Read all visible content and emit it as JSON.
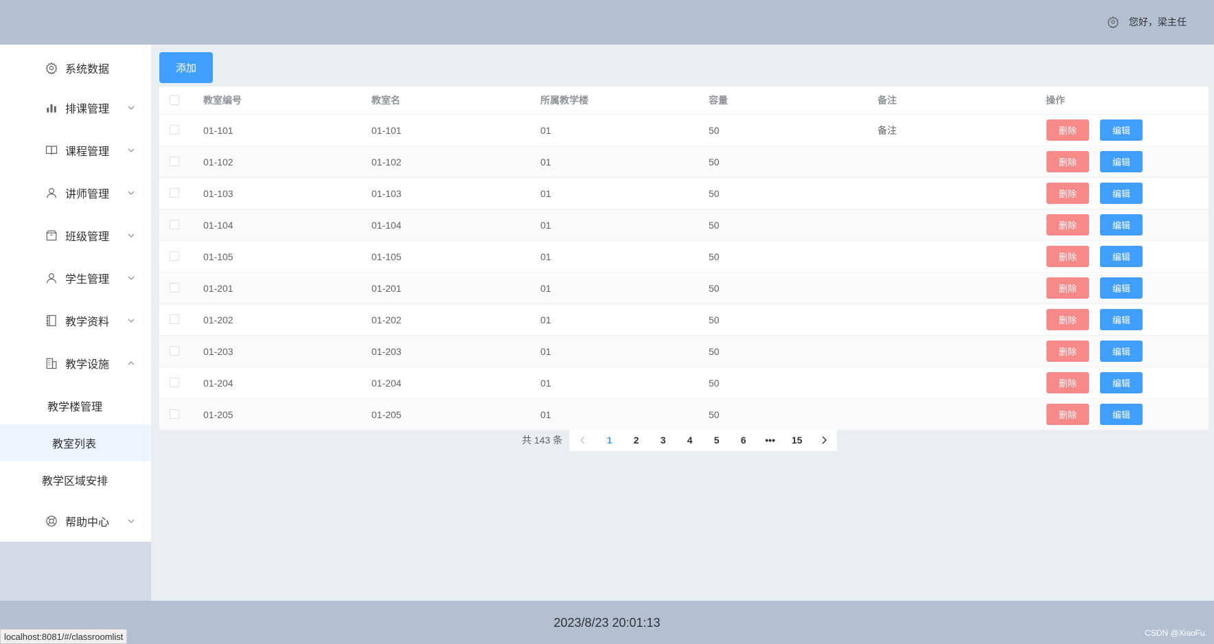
{
  "header": {
    "greeting": "您好，梁主任",
    "gear_icon": "gear-icon"
  },
  "sidebar": {
    "items": [
      {
        "label": "系统数据",
        "icon": "setting-icon",
        "chevron": null
      },
      {
        "label": "排课管理",
        "icon": "bar-chart-icon",
        "chevron": "down"
      },
      {
        "label": "课程管理",
        "icon": "book-icon",
        "chevron": "down"
      },
      {
        "label": "讲师管理",
        "icon": "user-icon",
        "chevron": "down"
      },
      {
        "label": "班级管理",
        "icon": "box-icon",
        "chevron": "down"
      },
      {
        "label": "学生管理",
        "icon": "user-icon",
        "chevron": "down"
      },
      {
        "label": "教学资料",
        "icon": "notebook-icon",
        "chevron": "down"
      },
      {
        "label": "教学设施",
        "icon": "building-icon",
        "chevron": "up"
      }
    ],
    "submenu": [
      {
        "label": "教学楼管理"
      },
      {
        "label": "教室列表",
        "active": true
      },
      {
        "label": "教学区域安排"
      }
    ],
    "help": {
      "label": "帮助中心",
      "icon": "lifebuoy-icon"
    }
  },
  "main": {
    "add_label": "添加",
    "table": {
      "headers": [
        "教室编号",
        "教室名",
        "所属教学楼",
        "容量",
        "备注",
        "操作"
      ],
      "rows": [
        {
          "code": "01-101",
          "name": "01-101",
          "building": "01",
          "capacity": "50",
          "remark": "备注"
        },
        {
          "code": "01-102",
          "name": "01-102",
          "building": "01",
          "capacity": "50",
          "remark": ""
        },
        {
          "code": "01-103",
          "name": "01-103",
          "building": "01",
          "capacity": "50",
          "remark": ""
        },
        {
          "code": "01-104",
          "name": "01-104",
          "building": "01",
          "capacity": "50",
          "remark": ""
        },
        {
          "code": "01-105",
          "name": "01-105",
          "building": "01",
          "capacity": "50",
          "remark": ""
        },
        {
          "code": "01-201",
          "name": "01-201",
          "building": "01",
          "capacity": "50",
          "remark": ""
        },
        {
          "code": "01-202",
          "name": "01-202",
          "building": "01",
          "capacity": "50",
          "remark": ""
        },
        {
          "code": "01-203",
          "name": "01-203",
          "building": "01",
          "capacity": "50",
          "remark": ""
        },
        {
          "code": "01-204",
          "name": "01-204",
          "building": "01",
          "capacity": "50",
          "remark": ""
        },
        {
          "code": "01-205",
          "name": "01-205",
          "building": "01",
          "capacity": "50",
          "remark": ""
        }
      ],
      "delete_label": "删除",
      "edit_label": "编辑"
    },
    "pagination": {
      "total_text": "共 143 条",
      "pages": [
        "1",
        "2",
        "3",
        "4",
        "5",
        "6",
        "•••",
        "15"
      ],
      "current": "1"
    }
  },
  "footer": {
    "clock": "2023/8/23 20:01:13",
    "watermark": "CSDN @XiaoFu."
  },
  "statusbar": {
    "url": "localhost:8081/#/classroomlist"
  },
  "colors": {
    "header_bg": "#b3c0d1",
    "primary": "#409eff",
    "danger": "#f78989",
    "main_bg": "#e9eef3"
  }
}
